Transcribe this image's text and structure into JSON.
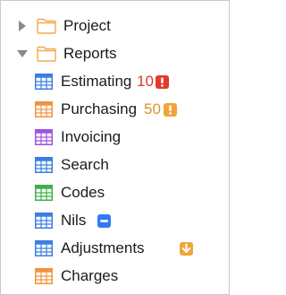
{
  "tree": {
    "folders": [
      {
        "label": "Project",
        "expanded": false
      },
      {
        "label": "Reports",
        "expanded": true
      }
    ],
    "items": [
      {
        "label": "Estimating",
        "icon": "blue-spreadsheet-icon",
        "color": "#3b7fe0",
        "count": "10",
        "count_color": "#e0392b",
        "badge": "exclamation-icon",
        "badge_color": "#e23b2c"
      },
      {
        "label": "Purchasing",
        "icon": "orange-spreadsheet-icon",
        "color": "#f0943e",
        "count": "50",
        "count_color": "#d9942c",
        "badge": "exclamation-icon",
        "badge_color": "#f0a43a"
      },
      {
        "label": "Invoicing",
        "icon": "purple-spreadsheet-icon",
        "color": "#a052e0"
      },
      {
        "label": "Search",
        "icon": "blue-spreadsheet-icon",
        "color": "#3b7fe0"
      },
      {
        "label": "Codes",
        "icon": "green-spreadsheet-icon",
        "color": "#3fb04c"
      },
      {
        "label": "Nils",
        "icon": "blue-spreadsheet-icon",
        "color": "#3b7fe0",
        "badge": "minus-icon",
        "badge_color": "#3478f6"
      },
      {
        "label": "Adjustments",
        "icon": "blue-spreadsheet-icon",
        "color": "#3b7fe0",
        "badge": "arrow-down-icon",
        "badge_color": "#f0a43a"
      },
      {
        "label": "Charges",
        "icon": "orange-spreadsheet-icon",
        "color": "#f0943e"
      }
    ],
    "folder_color": "#f3a94f"
  }
}
